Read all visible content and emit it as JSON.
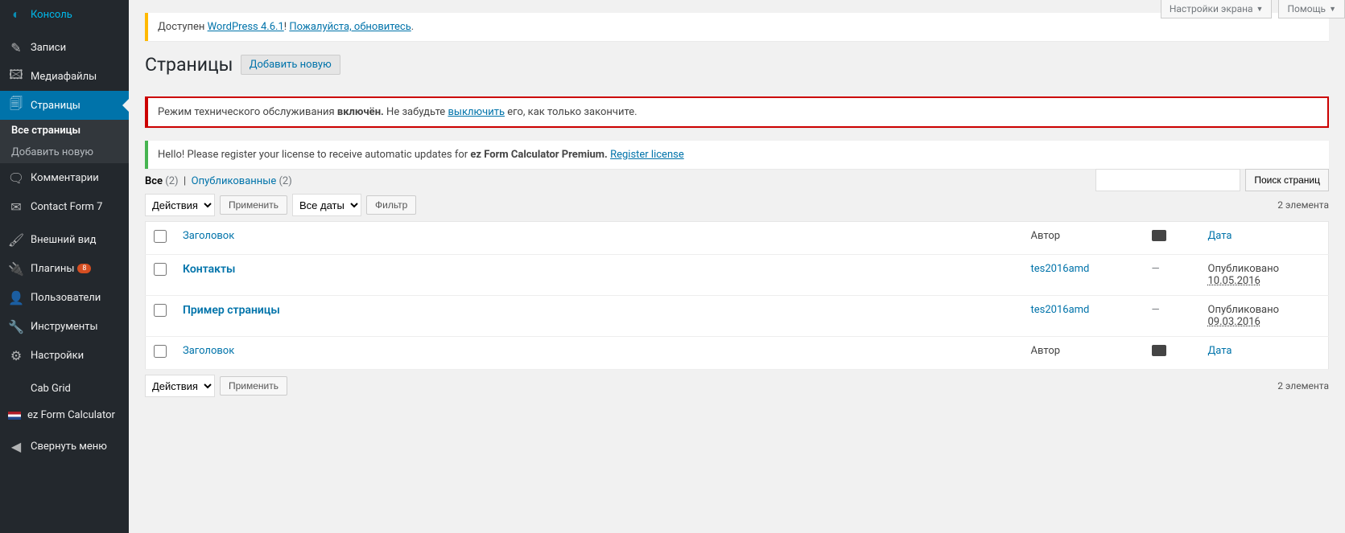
{
  "topButtons": {
    "screenOptions": "Настройки экрана",
    "help": "Помощь"
  },
  "sidebar": {
    "items": [
      {
        "label": "Консоль",
        "icon": "dash"
      },
      {
        "label": "Записи",
        "icon": "pin"
      },
      {
        "label": "Медиафайлы",
        "icon": "media"
      },
      {
        "label": "Страницы",
        "icon": "page",
        "active": true
      },
      {
        "label": "Комментарии",
        "icon": "comment"
      },
      {
        "label": "Contact Form 7",
        "icon": "mail"
      },
      {
        "label": "Внешний вид",
        "icon": "brush"
      },
      {
        "label": "Плагины",
        "icon": "plug",
        "badge": "8"
      },
      {
        "label": "Пользователи",
        "icon": "user"
      },
      {
        "label": "Инструменты",
        "icon": "tools"
      },
      {
        "label": "Настройки",
        "icon": "settings"
      },
      {
        "label": "Cab Grid",
        "icon": ""
      },
      {
        "label": "ez Form Calculator",
        "icon": "ez"
      },
      {
        "label": "Свернуть меню",
        "icon": "collapse"
      }
    ],
    "submenu": [
      {
        "label": "Все страницы",
        "current": true
      },
      {
        "label": "Добавить новую"
      }
    ]
  },
  "notices": {
    "update": {
      "pre": "Доступен ",
      "link1": "WordPress 4.6.1",
      "mid": "! ",
      "link2": "Пожалуйста, обновитесь",
      "post": "."
    },
    "maintenance": {
      "pre": "Режим технического обслуживания ",
      "strong": "включён.",
      "mid": " Не забудьте ",
      "link": "выключить",
      "post": " его, как только закончите."
    },
    "license": {
      "pre": "Hello! Please register your license to receive automatic updates for ",
      "strong": "ez Form Calculator Premium.",
      "sp": " ",
      "link": "Register license"
    }
  },
  "heading": {
    "title": "Страницы",
    "addNew": "Добавить новую"
  },
  "filters": {
    "allLabel": "Все",
    "allCount": "(2)",
    "pubLabel": "Опубликованные",
    "pubCount": "(2)",
    "bulkAction": "Действия",
    "apply": "Применить",
    "allDates": "Все даты",
    "filterBtn": "Фильтр",
    "itemsCount": "2 элемента"
  },
  "search": {
    "placeholder": "",
    "button": "Поиск страниц"
  },
  "table": {
    "cols": {
      "title": "Заголовок",
      "author": "Автор",
      "date": "Дата"
    },
    "rows": [
      {
        "title": "Контакты",
        "author": "tes2016amd",
        "comments": "—",
        "status": "Опубликовано",
        "date": "10.05.2016"
      },
      {
        "title": "Пример страницы",
        "author": "tes2016amd",
        "comments": "—",
        "status": "Опубликовано",
        "date": "09.03.2016"
      }
    ]
  }
}
